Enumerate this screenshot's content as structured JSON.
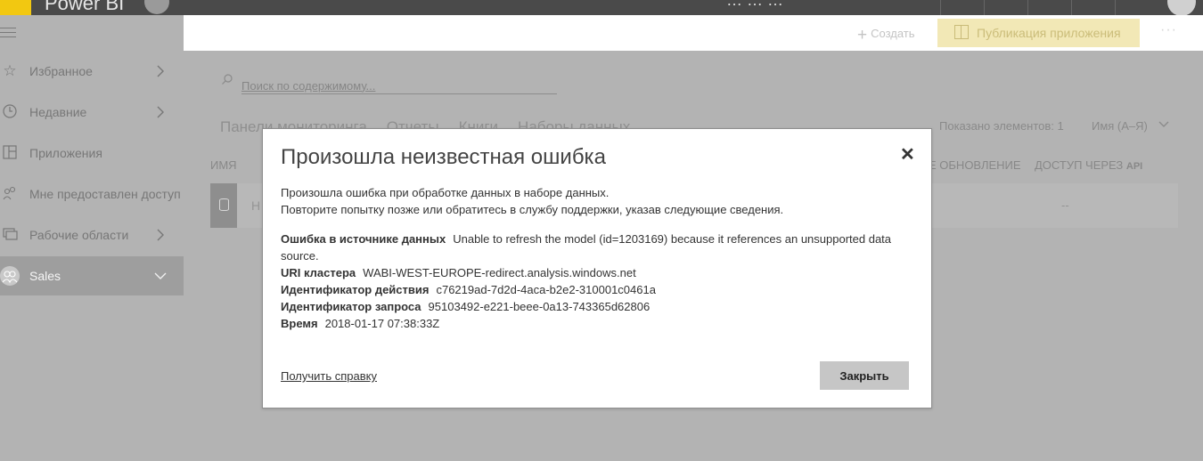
{
  "topbar": {
    "app_title": "Power BI",
    "fragment_text": "… … …"
  },
  "nav": {
    "items": [
      {
        "label": "Избранное",
        "icon": "star-icon"
      },
      {
        "label": "Недавние",
        "icon": "clock-icon"
      },
      {
        "label": "Приложения",
        "icon": "apps-icon"
      },
      {
        "label": "Мне предоставлен доступ",
        "icon": "shared-icon"
      },
      {
        "label": "Рабочие области",
        "icon": "workspaces-icon"
      },
      {
        "label": "Sales",
        "icon": "group-icon"
      }
    ]
  },
  "toolbar": {
    "create_label": "Создать",
    "publish_label": "Публикация приложения",
    "more_label": "···"
  },
  "search": {
    "placeholder": "Поиск по содержимому..."
  },
  "tabs": [
    "Панели мониторинга",
    "Отчеты",
    "Книги",
    "Наборы данных"
  ],
  "list": {
    "shown_count": "Показано элементов: 1",
    "sort_label": "Имя (А–Я)",
    "columns": {
      "name": "ИМЯ",
      "updated": "Е ОБНОВЛЕНИЕ",
      "access": "ДОСТУП ЧЕРЕЗ",
      "api": "API"
    },
    "rows": [
      {
        "name": "Н",
        "access": "--"
      }
    ]
  },
  "dialog": {
    "title": "Произошла неизвестная ошибка",
    "message_line1": "Произошла ошибка при обработке данных в наборе данных.",
    "message_line2": "Повторите попытку позже или обратитесь в службу поддержки, указав следующие сведения.",
    "details": [
      {
        "key": "Ошибка в источнике данных",
        "value": "Unable to refresh the model (id=1203169) because it references an unsupported data source."
      },
      {
        "key": "URI кластера",
        "value": "WABI-WEST-EUROPE-redirect.analysis.windows.net"
      },
      {
        "key": "Идентификатор действия",
        "value": "c76219ad-7d2d-4aca-b2e2-310001c0461a"
      },
      {
        "key": "Идентификатор запроса",
        "value": "95103492-e221-beee-0a13-743365d62806"
      },
      {
        "key": "Время",
        "value": "2018-01-17 07:38:33Z"
      }
    ],
    "help_link": "Получить справку",
    "close_button": "Закрыть"
  }
}
